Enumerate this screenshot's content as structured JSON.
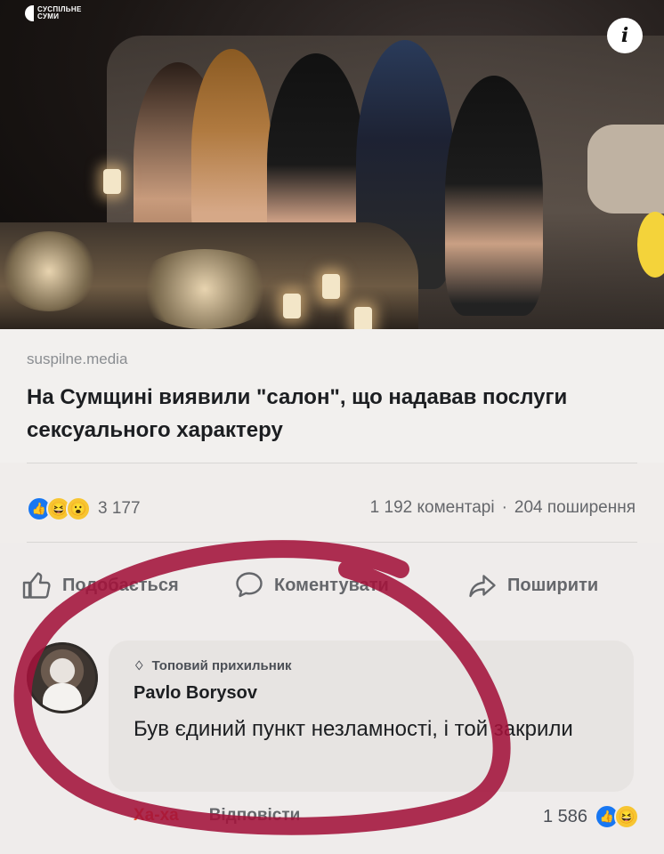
{
  "photo": {
    "logo_line1": "СУСПІЛЬНЕ",
    "logo_line2": "СУМИ",
    "info_icon": "info-icon",
    "info_glyph": "i"
  },
  "preview": {
    "source": "suspilne.media",
    "headline": "На Сумщині виявили \"салон\", що надавав послуги сексуального характеру"
  },
  "stats": {
    "reactions": [
      "like",
      "haha",
      "wow"
    ],
    "reaction_count": "3 177",
    "comments": "1 192 коментарі",
    "separator": "·",
    "shares": "204 поширення"
  },
  "actions": {
    "like": "Подобається",
    "comment": "Коментувати",
    "share": "Поширити"
  },
  "comment": {
    "badge": "Топовий прихильник",
    "author": "Pavlo Borysov",
    "text": "Був єдиний пункт незламності, і той закрили",
    "react_link": "Ха-ха",
    "reply_link": "Відповісти",
    "reaction_count": "1 586",
    "reactions": [
      "like",
      "haha"
    ]
  },
  "colors": {
    "facebook_blue": "#1877f2",
    "haha_yellow": "#f7c531",
    "marker_red": "#a3123a",
    "muted_text": "#65676b"
  }
}
